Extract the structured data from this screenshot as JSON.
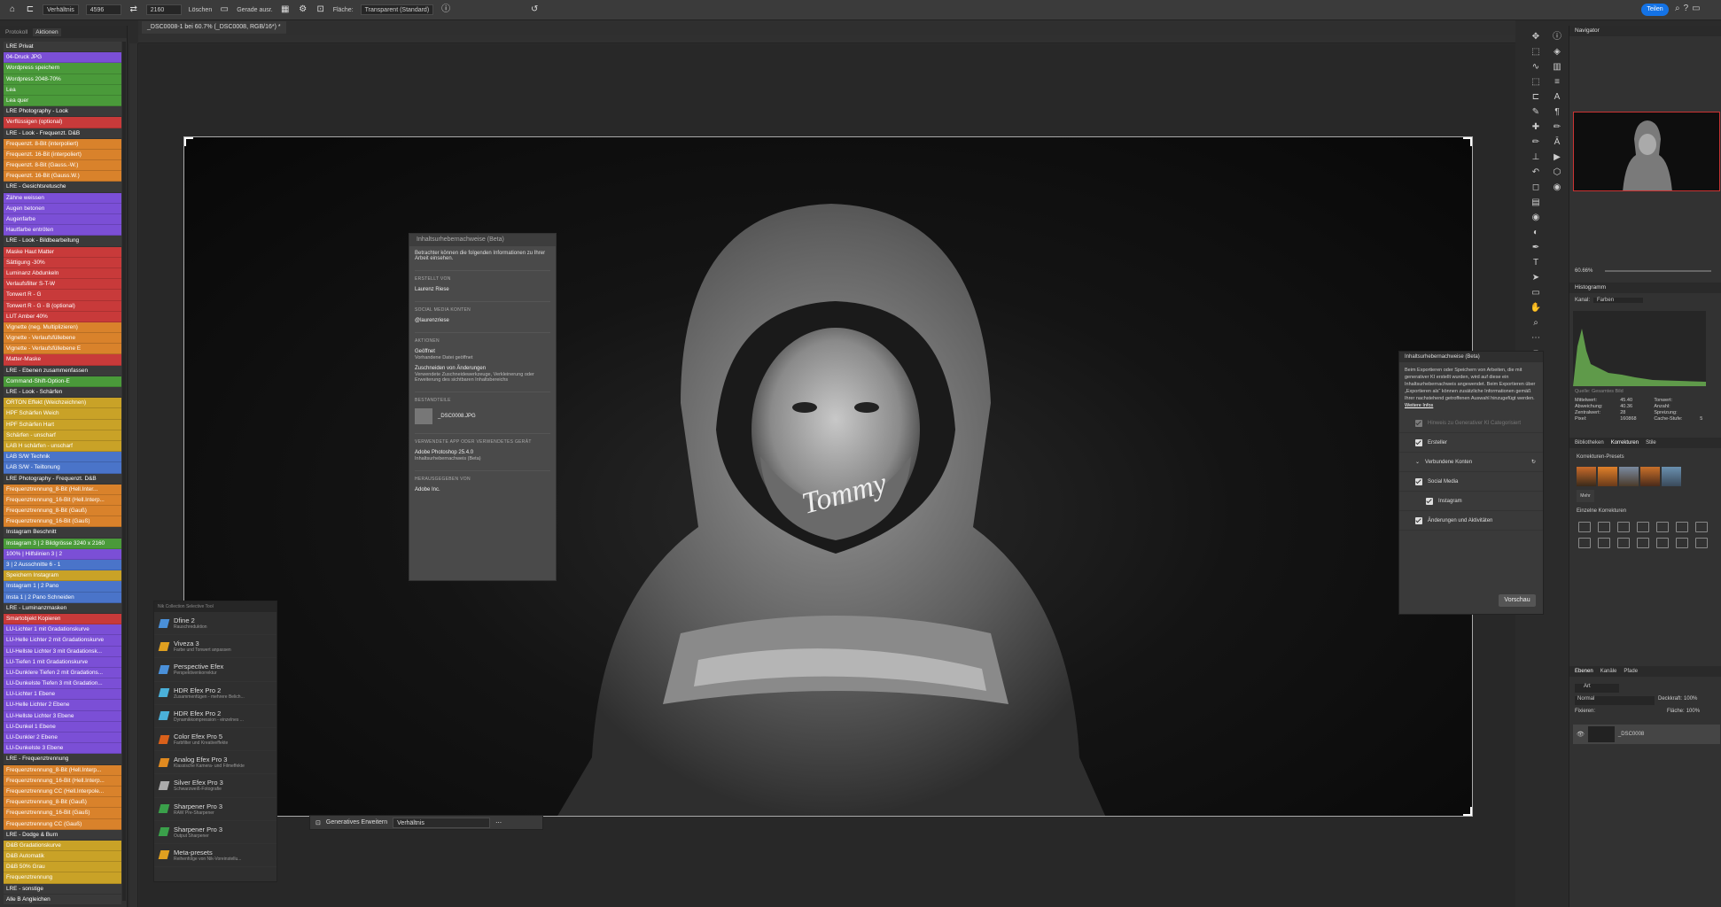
{
  "options_bar": {
    "ratio_label": "Verhältnis",
    "width_value": "4596",
    "height_value": "2160",
    "clear_label": "Löschen",
    "straighten_label": "Gerade ausr.",
    "fill_label": "Fläche:",
    "fill_value": "Transparent (Standard)",
    "share_label": "Teilen"
  },
  "document_tab": "_DSC0008-1 bei 60.7% (_DSC0008, RGB/16*) *",
  "left_panel": {
    "tabs": [
      "Protokoll",
      "Aktionen"
    ],
    "actions": [
      {
        "label": "LRE Privat",
        "color": "#3a3a3a"
      },
      {
        "label": "04-Druck JPG",
        "color": "#7b4fd6"
      },
      {
        "label": "Wordpress speichern",
        "color": "#4a9a3a"
      },
      {
        "label": "Wordpress 2048-70%",
        "color": "#4a9a3a"
      },
      {
        "label": "Lea",
        "color": "#4a9a3a"
      },
      {
        "label": "Lea quer",
        "color": "#4a9a3a"
      },
      {
        "label": "LRE Photography - Look",
        "color": "#3a3a3a"
      },
      {
        "label": "Verflüssigen (optional)",
        "color": "#c83a3a"
      },
      {
        "label": "LRE - Look - Frequenzt. D&B",
        "color": "#3a3a3a"
      },
      {
        "label": "Frequenzt. 8-Bit (interpoliert)",
        "color": "#d9822b"
      },
      {
        "label": "Frequenzt. 16-Bit (interpoliert)",
        "color": "#d9822b"
      },
      {
        "label": "Frequenzt. 8-Bit (Gauss.-W.)",
        "color": "#d9822b"
      },
      {
        "label": "Frequenzt. 16-Bit (Gauss.W.)",
        "color": "#d9822b"
      },
      {
        "label": "LRE - Gesichtsretusche",
        "color": "#3a3a3a"
      },
      {
        "label": "Zähne weissen",
        "color": "#7b4fd6"
      },
      {
        "label": "Augen betonen",
        "color": "#7b4fd6"
      },
      {
        "label": "Augenfarbe",
        "color": "#7b4fd6"
      },
      {
        "label": "Hautfarbe entröten",
        "color": "#7b4fd6"
      },
      {
        "label": "LRE - Look - Bildbearbeitung",
        "color": "#3a3a3a"
      },
      {
        "label": "Maske Haut Matter",
        "color": "#c83a3a"
      },
      {
        "label": "Sättigung -30%",
        "color": "#c83a3a"
      },
      {
        "label": "Luminanz Abdunkeln",
        "color": "#c83a3a"
      },
      {
        "label": "Verlaufsfilter S-T-W",
        "color": "#c83a3a"
      },
      {
        "label": "Tonwert R - G",
        "color": "#c83a3a"
      },
      {
        "label": "Tonwert R - G - B (optional)",
        "color": "#c83a3a"
      },
      {
        "label": "LUT Amber 40%",
        "color": "#c83a3a"
      },
      {
        "label": "Vignette (neg. Multiplizieren)",
        "color": "#d9822b"
      },
      {
        "label": "Vignette - Verlaufsfüllebene",
        "color": "#d9822b"
      },
      {
        "label": "Vignette - Verlaufsfüllebene E",
        "color": "#d9822b"
      },
      {
        "label": "Matter-Maske",
        "color": "#c83a3a"
      },
      {
        "label": "LRE - Ebenen zusammenfassen",
        "color": "#3a3a3a"
      },
      {
        "label": "Command-Shift-Option-E",
        "color": "#4a9a3a"
      },
      {
        "label": "LRE - Look - Schärfen",
        "color": "#3a3a3a"
      },
      {
        "label": "ORTON Effekt (Weichzeichnen)",
        "color": "#c9a227"
      },
      {
        "label": "HPF Schärfen Weich",
        "color": "#c9a227"
      },
      {
        "label": "HPF Schärfen Hart",
        "color": "#c9a227"
      },
      {
        "label": "Schärfen - unscharf",
        "color": "#c9a227"
      },
      {
        "label": "LAB H schärfen - unscharf",
        "color": "#c9a227"
      },
      {
        "label": "LAB S/W Technik",
        "color": "#4a74c9"
      },
      {
        "label": "LAB S/W - Teiltonung",
        "color": "#4a74c9"
      },
      {
        "label": "LRE Photography - Frequenzt. D&B",
        "color": "#3a3a3a"
      },
      {
        "label": "Frequenztrennung_8-Bit (Hell.Inter...",
        "color": "#d9822b"
      },
      {
        "label": "Frequenztrennung_16-Bit (Hell.Interp...",
        "color": "#d9822b"
      },
      {
        "label": "Frequenztrennung_8-Bit (Gauß)",
        "color": "#d9822b"
      },
      {
        "label": "Frequenztrennung_16-Bit (Gauß)",
        "color": "#d9822b"
      },
      {
        "label": "Instagram Beschnitt",
        "color": "#3a3a3a"
      },
      {
        "label": "Instagram 3 | 2 Bildgrösse 3240 x 2160",
        "color": "#4a9a3a"
      },
      {
        "label": "100% | Hilfslinien 3 | 2",
        "color": "#7b4fd6"
      },
      {
        "label": "3 | 2 Ausschnitte 6 - 1",
        "color": "#4a74c9"
      },
      {
        "label": "Speichern Instagram",
        "color": "#c9a227"
      },
      {
        "label": "Instagram 1 | 2 Pano",
        "color": "#4a74c9"
      },
      {
        "label": "Insta 1 | 2 Pano Schneiden",
        "color": "#4a74c9"
      },
      {
        "label": "LRE - Luminanzmasken",
        "color": "#3a3a3a"
      },
      {
        "label": "Smartobjekt Kopieren",
        "color": "#c83a3a"
      },
      {
        "label": "LU-Lichter 1 mit Gradationskurve",
        "color": "#7b4fd6"
      },
      {
        "label": "LU-Helle Lichter 2 mit Gradationskurve",
        "color": "#7b4fd6"
      },
      {
        "label": "LU-Hellste Lichter 3 mit Gradationsk...",
        "color": "#7b4fd6"
      },
      {
        "label": "LU-Tiefen 1 mit Gradationskurve",
        "color": "#7b4fd6"
      },
      {
        "label": "LU-Dunklere Tiefen 2 mit Gradations...",
        "color": "#7b4fd6"
      },
      {
        "label": "LU-Dunkelste Tiefen 3 mit Gradation...",
        "color": "#7b4fd6"
      },
      {
        "label": "LU-Lichter 1 Ebene",
        "color": "#7b4fd6"
      },
      {
        "label": "LU-Helle Lichter 2 Ebene",
        "color": "#7b4fd6"
      },
      {
        "label": "LU-Hellste Lichter 3 Ebene",
        "color": "#7b4fd6"
      },
      {
        "label": "LU-Dunkel 1 Ebene",
        "color": "#7b4fd6"
      },
      {
        "label": "LU-Dunkler 2 Ebene",
        "color": "#7b4fd6"
      },
      {
        "label": "LU-Dunkelste 3 Ebene",
        "color": "#7b4fd6"
      },
      {
        "label": "LRE - Frequenztrennung",
        "color": "#3a3a3a"
      },
      {
        "label": "Frequenztrennung_8-Bit (Hell.Interp...",
        "color": "#d9822b"
      },
      {
        "label": "Frequenztrennung_16-Bit (Hell.Interp...",
        "color": "#d9822b"
      },
      {
        "label": "Frequenztrennung CC (Hell.Interpole...",
        "color": "#d9822b"
      },
      {
        "label": "Frequenztrennung_8-Bit (Gauß)",
        "color": "#d9822b"
      },
      {
        "label": "Frequenztrennung_16-Bit (Gauß)",
        "color": "#d9822b"
      },
      {
        "label": "Frequenztrennung CC (Gauß)",
        "color": "#d9822b"
      },
      {
        "label": "LRE - Dodge & Burn",
        "color": "#3a3a3a"
      },
      {
        "label": "D&B Gradationskurve",
        "color": "#c9a227"
      },
      {
        "label": "D&B Automatik",
        "color": "#c9a227"
      },
      {
        "label": "D&B 50% Grau",
        "color": "#c9a227"
      },
      {
        "label": "Frequenztrennung",
        "color": "#c9a227"
      },
      {
        "label": "LRE - sonstige",
        "color": "#3a3a3a"
      },
      {
        "label": "Alle B Angleichen",
        "color": "#3a3a3a"
      }
    ]
  },
  "content_credentials_popup": {
    "title": "Inhaltsurhebernachweise (Beta)",
    "intro": "Betrachter können die folgenden Informationen zu Ihrer Arbeit einsehen.",
    "created_by_label": "ERSTELLT VON",
    "created_by": "Laurenz Riese",
    "social_label": "SOCIAL MEDIA KONTEN",
    "social_value": "@laurenzriese",
    "actions_label": "AKTIONEN",
    "action1_title": "Geöffnet",
    "action1_sub": "Vorhandene Datei geöffnet",
    "action2_title": "Zuschneiden von Änderungen",
    "action2_sub": "Verwendete Zuschneidewerkzeuge, Verkleinerung oder Erweiterung des sichtbaren Inhaltsbereichs",
    "ingredients_label": "BESTANDTEILE",
    "ingredient_file": "_DSC0008.JPG",
    "app_label": "VERWENDETE APP ODER VERWENDETES GERÄT",
    "app_name": "Adobe Photoshop 25.4.0",
    "app_sub": "Inhaltsurhebernachweis (Beta)",
    "publisher_label": "HERAUSGEGEBEN VON",
    "publisher": "Adobe Inc."
  },
  "nik_panel": {
    "header": "Nik Collection Selective Tool",
    "items": [
      {
        "name": "Dfine 2",
        "sub": "Rauschreduktion",
        "color": "#4a90d9"
      },
      {
        "name": "Viveza 3",
        "sub": "Farbe und Tonwert anpassen",
        "color": "#e0a020"
      },
      {
        "name": "Perspective Efex",
        "sub": "Perspektivenkorrektur",
        "color": "#4a90d9"
      },
      {
        "name": "HDR Efex Pro 2",
        "sub": "Zusammenfügen - mehrere Belich...",
        "color": "#4ab0d9"
      },
      {
        "name": "HDR Efex Pro 2",
        "sub": "Dynamikkompression - einzelnes ...",
        "color": "#4ab0d9"
      },
      {
        "name": "Color Efex Pro 5",
        "sub": "Farbfilter und Kreativeffekte",
        "color": "#d9601a"
      },
      {
        "name": "Analog Efex Pro 3",
        "sub": "Klassische Kamera- und Filmeffekte",
        "color": "#e08a20"
      },
      {
        "name": "Silver Efex Pro 3",
        "sub": "Schwarzweiß-Fotografie",
        "color": "#aaaaaa"
      },
      {
        "name": "Sharpener Pro 3",
        "sub": "RAW Pre-Sharpener",
        "color": "#3aa04a"
      },
      {
        "name": "Sharpener Pro 3",
        "sub": "Output Sharpener",
        "color": "#3aa04a"
      },
      {
        "name": "Meta-presets",
        "sub": "Reihenfolge von Nik-Voreinstellu...",
        "color": "#e0a020"
      }
    ]
  },
  "context_bar": {
    "generative_expand": "Generatives Erweitern",
    "ratio": "Verhältnis"
  },
  "navigator": {
    "title": "Navigator",
    "zoom": "60.66%"
  },
  "histogram": {
    "title": "Histogramm",
    "channel_label": "Kanal:",
    "channel_value": "Farben",
    "source": "Quelle: Gesamtes Bild",
    "mean_label": "Mittelwert:",
    "mean": "45.40",
    "stddev_label": "Abweichung:",
    "stddev": "40.36",
    "median_label": "Zentralwert:",
    "median": "28",
    "pixels_label": "Pixel:",
    "pixels": "160868",
    "level_label": "Tonwert:",
    "count_label": "Anzahl:",
    "percentile_label": "Spreizung:",
    "cache_label": "Cache-Stufe:",
    "cache": "5"
  },
  "credentials_panel": {
    "title": "Inhaltsurhebernachweise (Beta)",
    "desc": "Beim Exportieren oder Speichern von Arbeiten, die mit generativer KI erstellt wurden, wird auf diese ein Inhaltsurhebernachweis angewendet. Beim Exportieren über „Exportieren als“ können zusätzliche Informationen gemäß Ihrer nachstehend getroffenen Auswahl hinzugefügt werden.",
    "more_info": "Weitere Infos",
    "gen_ai_row": "Hinweis zu Generativer KI Categorisiert",
    "creator": "Ersteller",
    "connected_accounts": "Verbundene Konten",
    "social_media": "Social Media",
    "instagram": "Instagram",
    "edits": "Änderungen und Aktivitäten",
    "preview": "Vorschau"
  },
  "adjustments": {
    "tabs": [
      "Bibliotheken",
      "Korrekturen",
      "Stile"
    ],
    "presets_label": "Korrekturen-Presets",
    "more_label": "Mehr",
    "single_label": "Einzelne Korrekturen"
  },
  "layers": {
    "tabs": [
      "Ebenen",
      "Kanäle",
      "Pfade"
    ],
    "filter_value": "Art",
    "blend_mode": "Normal",
    "opacity_label": "Deckkraft:",
    "opacity": "100%",
    "lock_label": "Fixieren:",
    "fill_label": "Fläche:",
    "fill": "100%",
    "layer_name": "_DSC0008"
  }
}
